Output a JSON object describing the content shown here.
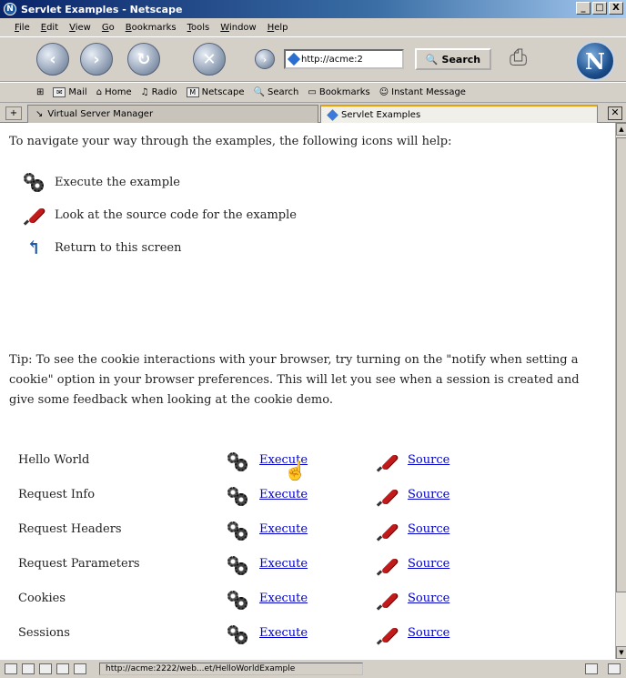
{
  "window": {
    "title": "Servlet Examples - Netscape",
    "buttons": [
      "_",
      "□",
      "X"
    ]
  },
  "menu": [
    "File",
    "Edit",
    "View",
    "Go",
    "Bookmarks",
    "Tools",
    "Window",
    "Help"
  ],
  "nav": {
    "url": "http://acme:2",
    "search_label": "Search"
  },
  "personal_toolbar": [
    "Mail",
    "Home",
    "Radio",
    "Netscape",
    "Search",
    "Bookmarks",
    "Instant Message"
  ],
  "tabs": [
    {
      "label": "Virtual Server Manager",
      "active": false
    },
    {
      "label": "Servlet Examples",
      "active": true
    }
  ],
  "content": {
    "intro": "To navigate your way through the examples, the following icons will help:",
    "legend": [
      {
        "icon": "gears-icon",
        "text": "Execute the example"
      },
      {
        "icon": "pen-icon",
        "text": "Look at the source code for the example"
      },
      {
        "icon": "return-icon",
        "text": "Return to this screen"
      }
    ],
    "tip": "Tip: To see the cookie interactions with your browser, try turning on the \"notify when setting a cookie\" option in your browser preferences. This will let you see when a session is created and give some feedback when looking at the cookie demo.",
    "examples": [
      {
        "name": "Hello World",
        "execute": "Execute",
        "source": "Source"
      },
      {
        "name": "Request Info",
        "execute": "Execute",
        "source": "Source"
      },
      {
        "name": "Request Headers",
        "execute": "Execute",
        "source": "Source"
      },
      {
        "name": "Request Parameters",
        "execute": "Execute",
        "source": "Source"
      },
      {
        "name": "Cookies",
        "execute": "Execute",
        "source": "Source"
      },
      {
        "name": "Sessions",
        "execute": "Execute",
        "source": "Source"
      }
    ]
  },
  "status": {
    "url": "http://acme:2222/web...et/HelloWorldExample"
  }
}
